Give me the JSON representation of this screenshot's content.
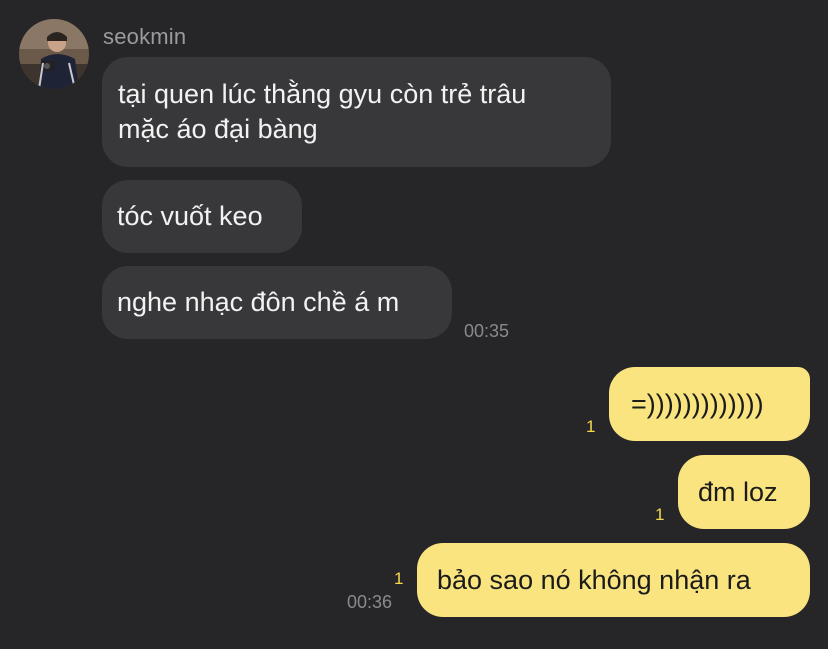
{
  "conversation": {
    "incoming": {
      "sender": "seokmin",
      "messages": [
        {
          "text": "tại quen lúc thằng gyu còn trẻ trâu\nmặc áo đại bàng"
        },
        {
          "text": "tóc vuốt keo"
        },
        {
          "text": "nghe nhạc đôn chề á m"
        }
      ],
      "time": "00:35"
    },
    "outgoing": {
      "messages": [
        {
          "text": "=)))))))))))))",
          "unread": "1"
        },
        {
          "text": "đm loz",
          "unread": "1"
        },
        {
          "text": "bảo sao nó không nhận ra",
          "unread": "1"
        }
      ],
      "time": "00:36"
    }
  },
  "colors": {
    "background": "#262628",
    "incoming_bubble": "#38383b",
    "outgoing_bubble": "#f9e480",
    "unread_count": "#f3d94f",
    "meta_text": "#8a8a8e"
  },
  "icons": {
    "avatar": "profile-photo-avatar"
  }
}
